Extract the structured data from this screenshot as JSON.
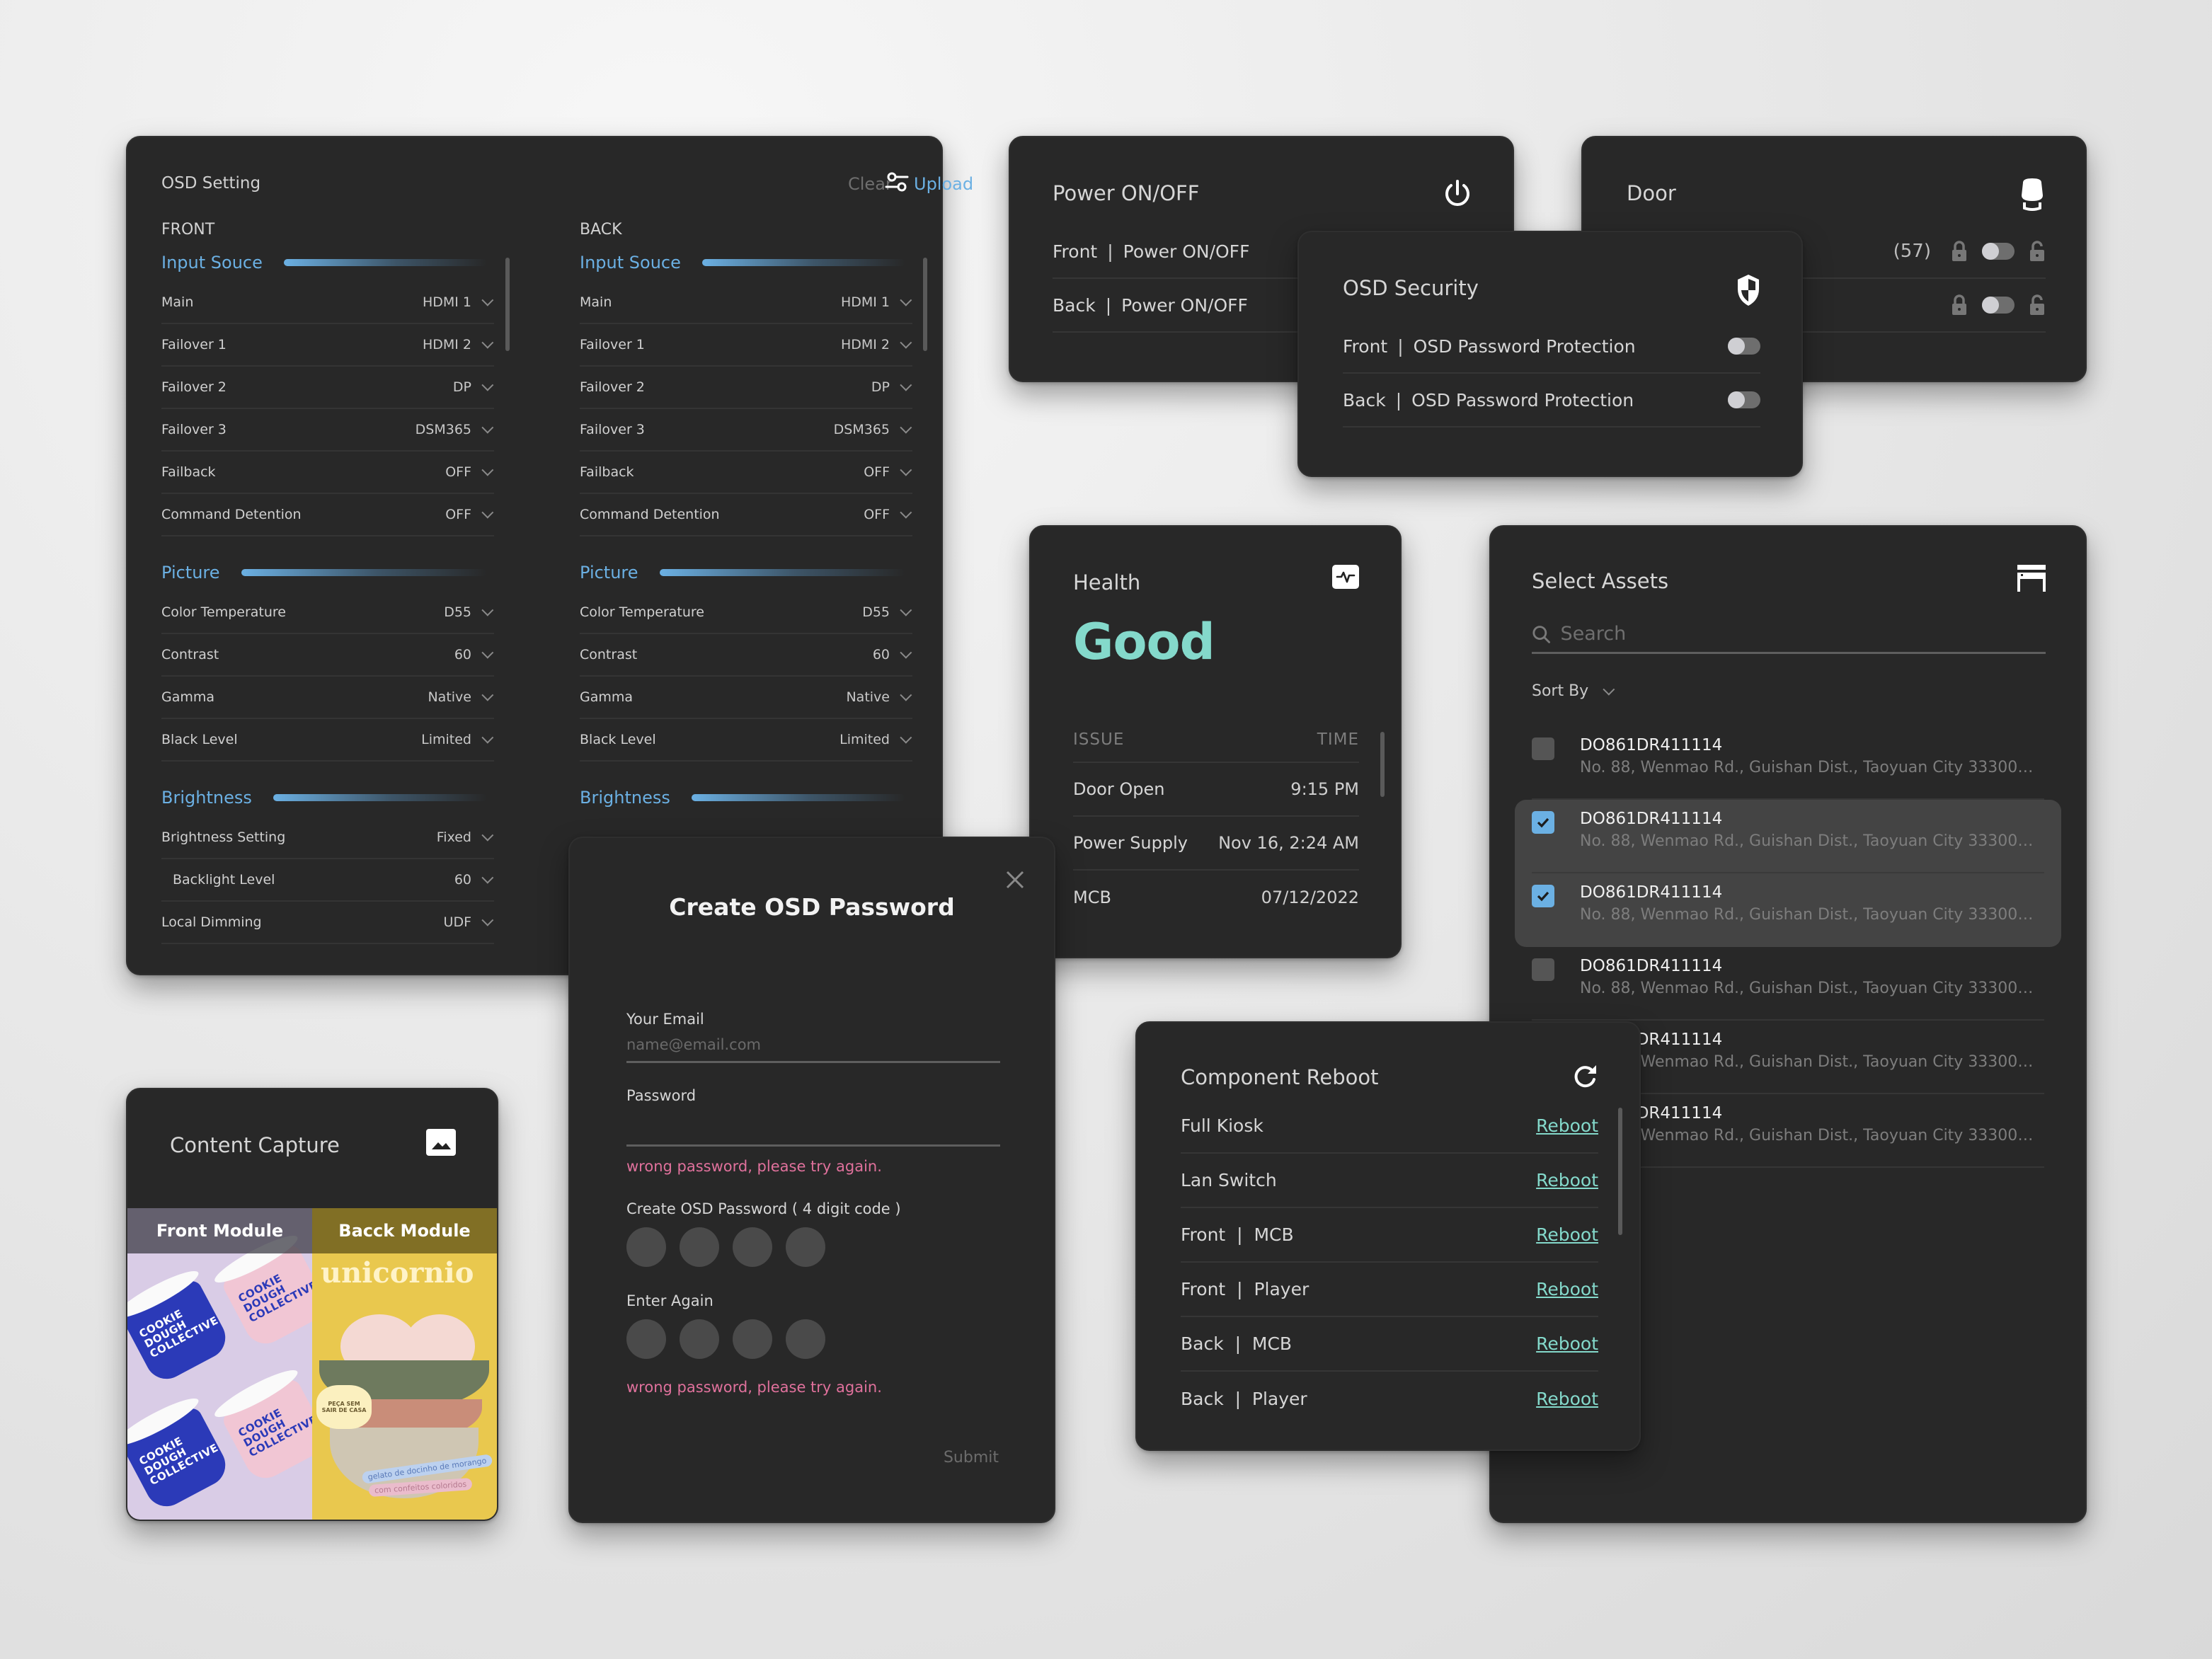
{
  "osd_setting": {
    "title": "OSD Setting",
    "clear_label": "Clear",
    "upload_label": "Upload",
    "filter_icon": "sliders-icon",
    "columns": [
      {
        "label": "FRONT",
        "sections": [
          {
            "name": "Input Souce",
            "rows": [
              {
                "label": "Main",
                "value": "HDMI 1"
              },
              {
                "label": "Failover 1",
                "value": "HDMI 2"
              },
              {
                "label": "Failover 2",
                "value": "DP"
              },
              {
                "label": "Failover 3",
                "value": "DSM365"
              },
              {
                "label": "Failback",
                "value": "OFF"
              },
              {
                "label": "Command Detention",
                "value": "OFF"
              }
            ]
          },
          {
            "name": "Picture",
            "rows": [
              {
                "label": "Color Temperature",
                "value": "D55"
              },
              {
                "label": "Contrast",
                "value": "60"
              },
              {
                "label": "Gamma",
                "value": "Native"
              },
              {
                "label": "Black Level",
                "value": "Limited"
              }
            ]
          },
          {
            "name": "Brightness",
            "rows": [
              {
                "label": "Brightness Setting",
                "value": "Fixed"
              },
              {
                "label": "Backlight Level",
                "value": "60",
                "indent": true
              },
              {
                "label": "Local Dimming",
                "value": "UDF"
              }
            ]
          }
        ]
      },
      {
        "label": "BACK",
        "sections": [
          {
            "name": "Input Souce",
            "rows": [
              {
                "label": "Main",
                "value": "HDMI 1"
              },
              {
                "label": "Failover 1",
                "value": "HDMI 2"
              },
              {
                "label": "Failover 2",
                "value": "DP"
              },
              {
                "label": "Failover 3",
                "value": "DSM365"
              },
              {
                "label": "Failback",
                "value": "OFF"
              },
              {
                "label": "Command Detention",
                "value": "OFF"
              }
            ]
          },
          {
            "name": "Picture",
            "rows": [
              {
                "label": "Color Temperature",
                "value": "D55"
              },
              {
                "label": "Contrast",
                "value": "60"
              },
              {
                "label": "Gamma",
                "value": "Native"
              },
              {
                "label": "Black Level",
                "value": "Limited"
              }
            ]
          },
          {
            "name": "Brightness",
            "rows": []
          }
        ]
      }
    ]
  },
  "power": {
    "title": "Power ON/OFF",
    "icon": "power-icon",
    "rows": [
      {
        "side": "Front",
        "label": "Power ON/OFF"
      },
      {
        "side": "Back",
        "label": "Power ON/OFF"
      }
    ]
  },
  "door": {
    "title": "Door",
    "icon": "door-icon",
    "rows": [
      {
        "count": "(57)",
        "state": "locked"
      },
      {
        "count": "",
        "state": "locked"
      }
    ]
  },
  "osd_security": {
    "title": "OSD Security",
    "icon": "shield-icon",
    "rows": [
      {
        "side": "Front",
        "label": "OSD Password Protection",
        "enabled": false
      },
      {
        "side": "Back",
        "label": "OSD Password Protection",
        "enabled": false
      }
    ]
  },
  "health": {
    "title": "Health",
    "icon": "pulse-icon",
    "status": "Good",
    "status_color": "#84d9cb",
    "columns": [
      "ISSUE",
      "TIME"
    ],
    "rows": [
      {
        "issue": "Door Open",
        "time": "9:15 PM"
      },
      {
        "issue": "Power Supply",
        "time": "Nov 16, 2:24 AM"
      },
      {
        "issue": "MCB",
        "time": "07/12/2022"
      }
    ]
  },
  "assets": {
    "title": "Select Assets",
    "icon": "kiosk-icon",
    "search_placeholder": "Search",
    "sort_label": "Sort By",
    "items": [
      {
        "id": "DO861DR411114",
        "address": "No. 88, Wenmao Rd., Guishan Dist., Taoyuan City 333001,..",
        "checked": false
      },
      {
        "id": "DO861DR411114",
        "address": "No. 88, Wenmao Rd., Guishan Dist., Taoyuan City 333001,..",
        "checked": true
      },
      {
        "id": "DO861DR411114",
        "address": "No. 88, Wenmao Rd., Guishan Dist., Taoyuan City 333001,..",
        "checked": true
      },
      {
        "id": "DO861DR411114",
        "address": "No. 88, Wenmao Rd., Guishan Dist., Taoyuan City 333001,..",
        "checked": false
      },
      {
        "id": "DO861DR411114",
        "address": "No. 88, Wenmao Rd., Guishan Dist., Taoyuan City 333001,..",
        "checked": false
      },
      {
        "id": "DO861DR411114",
        "address": "No. 88, Wenmao Rd., Guishan Dist., Taoyuan City 333001,..",
        "checked": false
      }
    ]
  },
  "reboot": {
    "title": "Component Reboot",
    "icon": "refresh-icon",
    "action_label": "Reboot",
    "rows": [
      {
        "label": "Full Kiosk"
      },
      {
        "label": "Lan Switch"
      },
      {
        "label": "Front  |  MCB"
      },
      {
        "label": "Front  |  Player"
      },
      {
        "label": "Back  |  MCB"
      },
      {
        "label": "Back  |  Player"
      }
    ]
  },
  "create_password": {
    "title": "Create OSD Password",
    "email_label": "Your Email",
    "email_placeholder": "name@email.com",
    "password_label": "Password",
    "password_error": "wrong password, please try again.",
    "pin_label": "Create OSD Password ( 4 digit code )",
    "pin_length": 4,
    "confirm_label": "Enter Again",
    "confirm_error": "wrong password, please try again.",
    "submit_label": "Submit"
  },
  "content_capture": {
    "title": "Content Capture",
    "icon": "image-icon",
    "front_label": "Front Module",
    "back_label": "Bacck Module",
    "front_cup_text": "COOKIE DOUGH COLLECTIVE",
    "back_poster_title": "unicornio",
    "back_badge": "PEÇA SEM SAIR DE CASA",
    "back_caption_1": "gelato de docinho de morango",
    "back_caption_2": "com confeitos coloridos"
  },
  "colors": {
    "accent_blue": "#6bb0e3",
    "accent_teal": "#84d9cb",
    "error_pink": "#e0719c",
    "card_bg": "#282828"
  }
}
